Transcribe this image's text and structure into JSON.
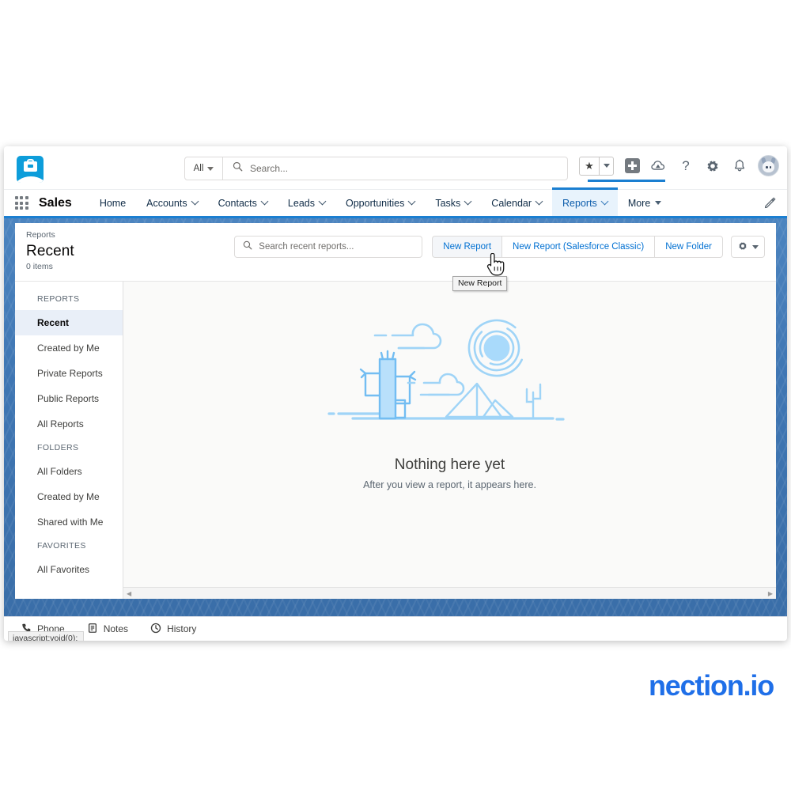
{
  "header": {
    "app_icon": "briefcase-cloud-icon",
    "app_name": "Sales",
    "global_search": {
      "scope_label": "All",
      "placeholder": "Search...",
      "value": ""
    },
    "icons": [
      {
        "name": "favorites-star-icon",
        "glyph": "★"
      },
      {
        "name": "favorites-dropdown-icon",
        "glyph": "▾"
      },
      {
        "name": "add-plus-icon",
        "glyph": "+"
      },
      {
        "name": "service-cloud-icon",
        "glyph": "☁"
      },
      {
        "name": "help-icon",
        "glyph": "?"
      },
      {
        "name": "setup-gear-icon",
        "glyph": "✲"
      },
      {
        "name": "notifications-bell-icon",
        "glyph": "🔔"
      },
      {
        "name": "user-avatar",
        "glyph": ""
      }
    ],
    "nav_items": [
      {
        "label": "Home",
        "has_dropdown": false,
        "active": false
      },
      {
        "label": "Accounts",
        "has_dropdown": true,
        "active": false
      },
      {
        "label": "Contacts",
        "has_dropdown": true,
        "active": false
      },
      {
        "label": "Leads",
        "has_dropdown": true,
        "active": false
      },
      {
        "label": "Opportunities",
        "has_dropdown": true,
        "active": false
      },
      {
        "label": "Tasks",
        "has_dropdown": true,
        "active": false
      },
      {
        "label": "Calendar",
        "has_dropdown": true,
        "active": false
      },
      {
        "label": "Reports",
        "has_dropdown": true,
        "active": true
      },
      {
        "label": "More",
        "has_dropdown": true,
        "active": false
      }
    ],
    "edit_nav_icon": "pencil-icon"
  },
  "page": {
    "breadcrumb": "Reports",
    "title": "Recent",
    "item_count": "0 items",
    "list_search": {
      "placeholder": "Search recent reports...",
      "value": ""
    },
    "buttons": [
      {
        "label": "New Report",
        "hovered": true
      },
      {
        "label": "New Report (Salesforce Classic)",
        "hovered": false
      },
      {
        "label": "New Folder",
        "hovered": false
      }
    ],
    "settings_button": {
      "icon": "gear-icon",
      "dropdown": "▾"
    }
  },
  "sidebar": {
    "sections": [
      {
        "heading": "REPORTS",
        "items": [
          {
            "label": "Recent",
            "active": true
          },
          {
            "label": "Created by Me",
            "active": false
          },
          {
            "label": "Private Reports",
            "active": false
          },
          {
            "label": "Public Reports",
            "active": false
          },
          {
            "label": "All Reports",
            "active": false
          }
        ]
      },
      {
        "heading": "FOLDERS",
        "items": [
          {
            "label": "All Folders",
            "active": false
          },
          {
            "label": "Created by Me",
            "active": false
          },
          {
            "label": "Shared with Me",
            "active": false
          }
        ]
      },
      {
        "heading": "FAVORITES",
        "items": [
          {
            "label": "All Favorites",
            "active": false
          }
        ]
      }
    ]
  },
  "empty_state": {
    "illustration": "desert-scene-illustration",
    "title": "Nothing here yet",
    "subtitle": "After you view a report, it appears here."
  },
  "utility_bar": {
    "items": [
      {
        "label": "Phone",
        "icon": "phone-icon"
      },
      {
        "label": "Notes",
        "icon": "notes-icon"
      },
      {
        "label": "History",
        "icon": "clock-icon"
      }
    ]
  },
  "tooltip": {
    "text": "New Report"
  },
  "status_bar": {
    "text": "javascript:void(0);"
  },
  "watermark": {
    "text": "nection.io"
  },
  "colors": {
    "brand_blue": "#1b7fd1",
    "link_blue": "#0070d2",
    "nav_band": "#3f76b3",
    "active_item_bg": "#e9eff8",
    "illustration_blue": "#9fd4f7",
    "watermark_blue": "#1f6fe8"
  }
}
